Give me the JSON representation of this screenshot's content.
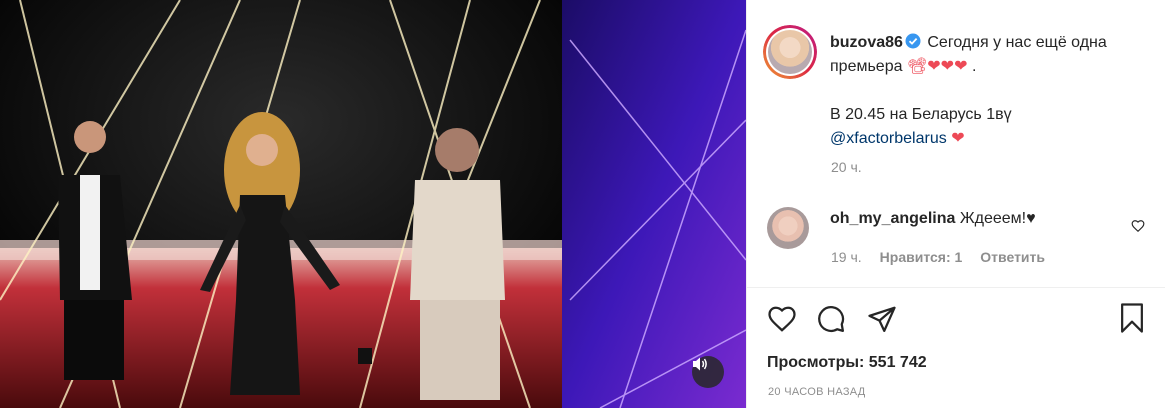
{
  "post": {
    "author": "buzova86",
    "caption_line1": "Сегодня у нас ещё одна премьера",
    "caption_emojis": "📽❤❤❤",
    "caption_dot": ".",
    "caption_line2": "В 20.45 на Беларусь 1вү",
    "mention": "@xfactorbelarus",
    "mention_emoji": "❤",
    "time": "20 ч."
  },
  "comment": {
    "user": "oh_my_angelina",
    "text": "Ждееем!♥",
    "time": "19 ч.",
    "likes": "Нравится: 1",
    "reply": "Ответить"
  },
  "stats": {
    "views": "Просмотры: 551 742",
    "ago": "20 ЧАСОВ НАЗАД"
  },
  "icons": {
    "verified": "verified-icon",
    "like": "heart-icon",
    "comment": "comment-icon",
    "share": "share-icon",
    "save": "bookmark-icon",
    "sound": "speaker-icon"
  },
  "colors": {
    "verified": "#3897f0",
    "heart": "#ed4956",
    "mention": "#00376b",
    "muted": "#8e8e8e"
  }
}
